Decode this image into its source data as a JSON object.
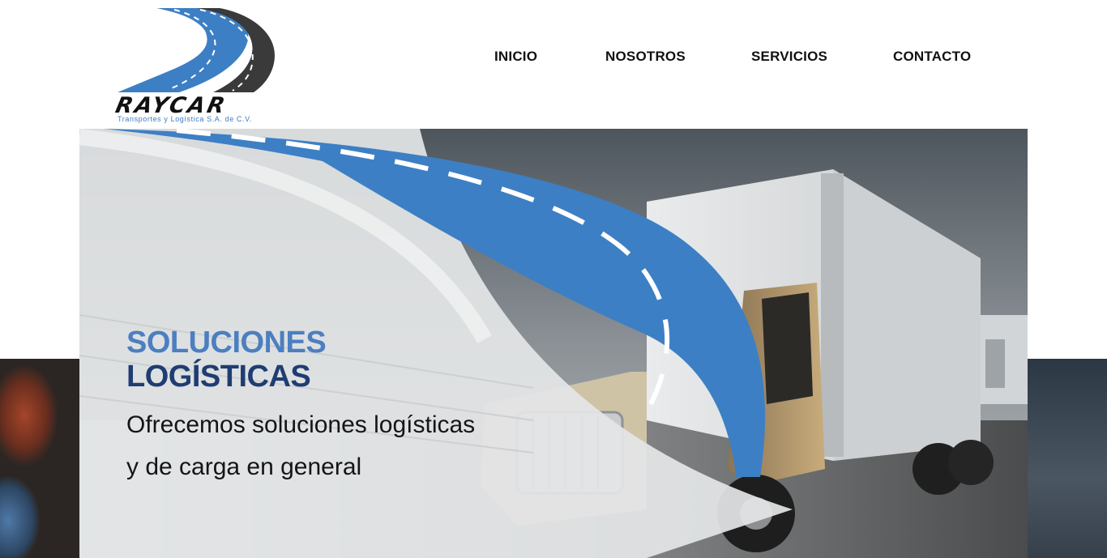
{
  "brand": {
    "name": "RAYCAR",
    "tagline": "Transportes y Logística S.A. de C.V."
  },
  "nav": {
    "items": [
      {
        "label": "INICIO"
      },
      {
        "label": "NOSOTROS"
      },
      {
        "label": "SERVICIOS"
      },
      {
        "label": "CONTACTO"
      }
    ]
  },
  "hero": {
    "headline_line1": "SOLUCIONES",
    "headline_line2": "LOGÍSTICAS",
    "subtitle_line1": "Ofrecemos soluciones logísticas",
    "subtitle_line2": "y de carga en general"
  },
  "colors": {
    "brand_blue": "#3d7fc4",
    "headline_light": "#4b7fc0",
    "headline_dark": "#1f3d72",
    "nav_text": "#111111"
  }
}
